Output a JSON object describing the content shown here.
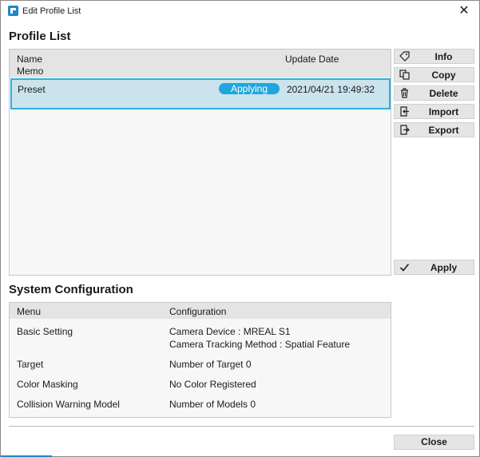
{
  "window": {
    "title": "Edit Profile List",
    "close_glyph": "✕"
  },
  "profile_list": {
    "title": "Profile List",
    "columns": {
      "name": "Name",
      "memo": "Memo",
      "update_date": "Update Date"
    },
    "rows": [
      {
        "name": "Preset",
        "status": "Applying",
        "update_date": "2021/04/21 19:49:32",
        "selected": true
      }
    ]
  },
  "actions": [
    {
      "label": "Info",
      "icon": "tag-icon"
    },
    {
      "label": "Copy",
      "icon": "copy-icon"
    },
    {
      "label": "Delete",
      "icon": "trash-icon"
    },
    {
      "label": "Import",
      "icon": "import-icon"
    },
    {
      "label": "Export",
      "icon": "export-icon"
    }
  ],
  "apply_button": {
    "label": "Apply",
    "icon": "checkmark-icon"
  },
  "system_configuration": {
    "title": "System Configuration",
    "columns": {
      "menu": "Menu",
      "configuration": "Configuration"
    },
    "rows": [
      {
        "menu": "Basic Setting",
        "configuration": [
          "Camera Device : MREAL S1",
          "Camera Tracking Method : Spatial Feature"
        ]
      },
      {
        "menu": "Target",
        "configuration": [
          "Number of Target 0"
        ]
      },
      {
        "menu": "Color Masking",
        "configuration": [
          "No Color Registered"
        ]
      },
      {
        "menu": "Collision Warning Model",
        "configuration": [
          "Number of Models 0"
        ]
      }
    ]
  },
  "close_button": {
    "label": "Close"
  },
  "colors": {
    "accent": "#1fa6de",
    "selection_fill": "#cbe3ec",
    "selection_border": "#2fb0dc",
    "header_gray": "#e4e4e4",
    "button_gray": "#e5e5e5"
  }
}
